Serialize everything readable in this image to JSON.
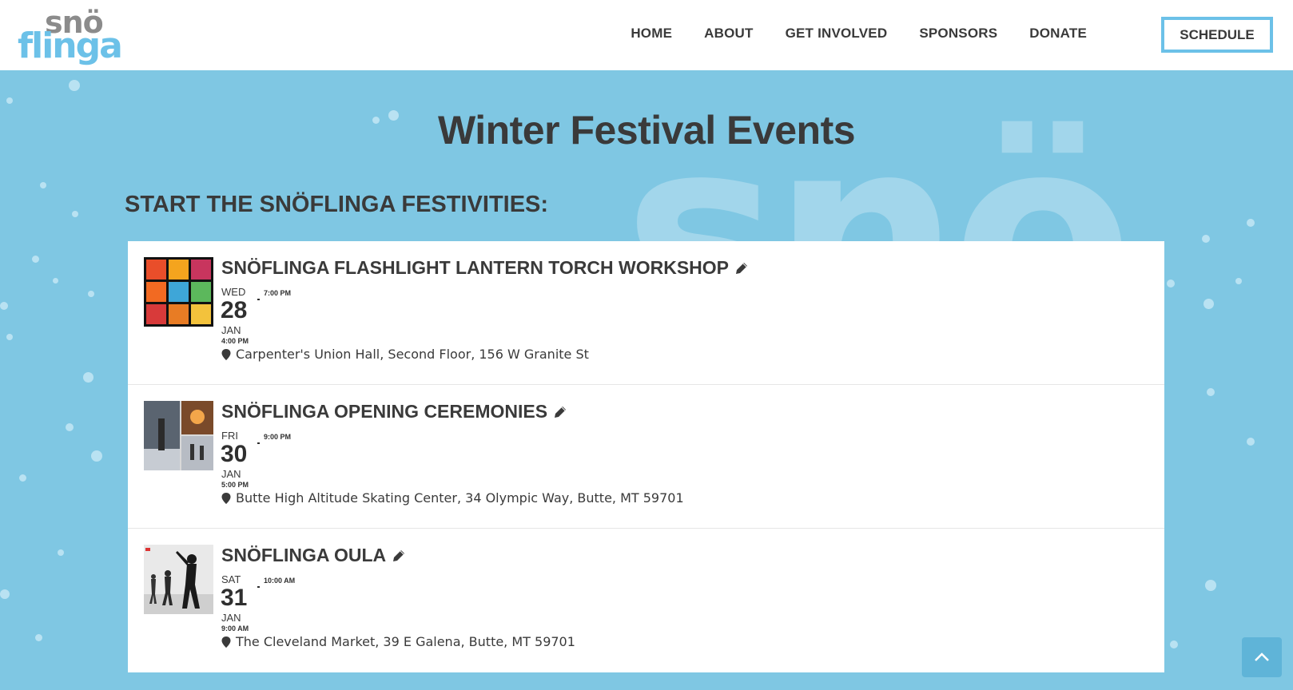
{
  "brand": {
    "logo_top": "snö",
    "logo_bottom": "flinga",
    "logo_gray": "#8b8b8b",
    "logo_blue": "#6cc1e8"
  },
  "nav": {
    "items": [
      "HOME",
      "ABOUT",
      "GET INVOLVED",
      "SPONSORS",
      "DONATE"
    ],
    "cta": "SCHEDULE"
  },
  "hero": {
    "watermark": "snö",
    "background": "#7fc7e3"
  },
  "page_title": "Winter Festival Events",
  "section_heading": "START THE SNÖFLINGA FESTIVITIES:",
  "events": [
    {
      "title": "SNÖFLINGA FLASHLIGHT LANTERN TORCH WORKSHOP",
      "dow": "WED",
      "day": "28",
      "month": "JAN",
      "start": "4:00 PM",
      "end": "7:00 PM",
      "location": "Carpenter's Union Hall, Second Floor, 156 W Granite St",
      "image": "colorful-lanterns-grid"
    },
    {
      "title": "SNÖFLINGA OPENING CEREMONIES",
      "dow": "FRI",
      "day": "30",
      "month": "JAN",
      "start": "5:00 PM",
      "end": "9:00 PM",
      "location": "Butte High Altitude Skating Center, 34 Olympic Way, Butte, MT 59701",
      "image": "skating-collage"
    },
    {
      "title": "SNÖFLINGA OULA",
      "dow": "SAT",
      "day": "31",
      "month": "JAN",
      "start": "9:00 AM",
      "end": "10:00 AM",
      "location": "The Cleveland Market, 39 E Galena, Butte, MT 59701",
      "image": "dance-silhouettes"
    }
  ],
  "icons": {
    "edit": "pencil-icon",
    "location": "map-pin-icon",
    "scroll_top": "chevron-up-icon"
  },
  "colors": {
    "accent": "#6cc1e8",
    "text": "#3a3a3a",
    "scroll_button": "#5fb4d8"
  }
}
